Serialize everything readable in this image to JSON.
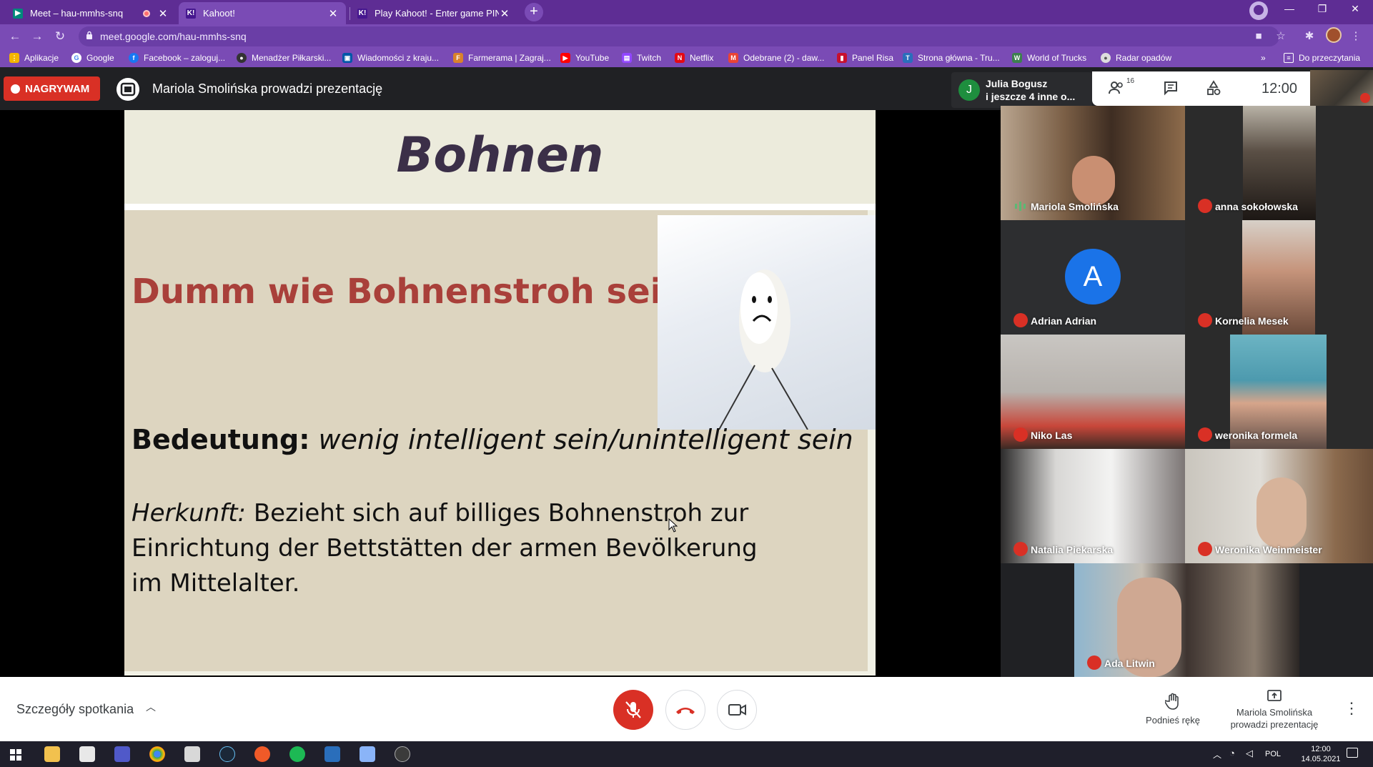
{
  "browser": {
    "tabs": [
      {
        "title": "Meet – hau-mmhs-snq",
        "icon": "google-meet-icon",
        "active": false
      },
      {
        "title": "Kahoot!",
        "icon": "kahoot-icon",
        "active": true
      },
      {
        "title": "Play Kahoot! - Enter game PIN here!",
        "icon": "kahoot-icon",
        "active": false
      }
    ],
    "url": "meet.google.com/hau-mmhs-snq",
    "bookmarks": [
      {
        "label": "Aplikacje",
        "icon": "apps-grid-icon",
        "color": "#f4b400"
      },
      {
        "label": "Google",
        "icon": "google-icon",
        "color": "#ffffff"
      },
      {
        "label": "Facebook – zaloguj...",
        "icon": "facebook-icon",
        "color": "#1877f2"
      },
      {
        "label": "Menadżer Piłkarski...",
        "icon": "football-icon",
        "color": "#333333"
      },
      {
        "label": "Wiadomości z kraju...",
        "icon": "news-icon",
        "color": "#0057a8"
      },
      {
        "label": "Farmerama | Zagraj...",
        "icon": "farmerama-icon",
        "color": "#d9822b"
      },
      {
        "label": "YouTube",
        "icon": "youtube-icon",
        "color": "#ff0000"
      },
      {
        "label": "Twitch",
        "icon": "twitch-icon",
        "color": "#9146ff"
      },
      {
        "label": "Netflix",
        "icon": "netflix-icon",
        "color": "#e50914"
      },
      {
        "label": "Odebrane (2) - daw...",
        "icon": "gmail-icon",
        "color": "#ea4335"
      },
      {
        "label": "Panel Risa",
        "icon": "bookmark-icon",
        "color": "#c8102e"
      },
      {
        "label": "Strona główna - Tru...",
        "icon": "trucks-icon",
        "color": "#2a6ebb"
      },
      {
        "label": "World of Trucks",
        "icon": "world-of-trucks-icon",
        "color": "#3d7f4f"
      },
      {
        "label": "Radar opadów",
        "icon": "radar-icon",
        "color": "#dddddd"
      }
    ],
    "reading_list": "Do przeczytania"
  },
  "meet": {
    "recording_label": "NAGRYWAM",
    "presenter_banner": "Mariola Smolińska prowadzi prezentację",
    "people_card": {
      "initial": "J",
      "line1": "Julia Bogusz",
      "line2": "i jeszcze 4 inne o..."
    },
    "participant_count": "16",
    "clock": "12:00",
    "details_label": "Szczegóły spotkania",
    "raise_hand_label": "Podnieś rękę",
    "presenting_label": "Mariola Smolińska\nprowadzi prezentację",
    "accent": "#d93025"
  },
  "slide": {
    "title": "Bohnen",
    "idiom": "Dumm wie Bohnenstroh sein",
    "meaning_label": "Bedeutung:",
    "meaning_text": "wenig intelligent sein/unintelligent sein",
    "origin_label": "Herkunft:",
    "origin_text": "Bezieht sich auf billiges Bohnenstroh zur Einrichtung der Bettstätten der armen Bevölkerung im Mittelalter."
  },
  "participants": [
    {
      "name": "Mariola Smolińska",
      "state": "speaking"
    },
    {
      "name": "anna sokołowska",
      "state": "muted"
    },
    {
      "name": "Adrian Adrian",
      "state": "muted",
      "avatar_letter": "A"
    },
    {
      "name": "Kornelia Mesek",
      "state": "muted"
    },
    {
      "name": "Niko Las",
      "state": "muted"
    },
    {
      "name": "weronika formela",
      "state": "muted"
    },
    {
      "name": "Natalia Piekarska",
      "state": "muted"
    },
    {
      "name": "Weronika Weinmeister",
      "state": "muted"
    },
    {
      "name": "Ada Litwin",
      "state": "muted"
    }
  ],
  "taskbar": {
    "language": "POL",
    "time": "12:00",
    "date": "14.05.2021"
  }
}
